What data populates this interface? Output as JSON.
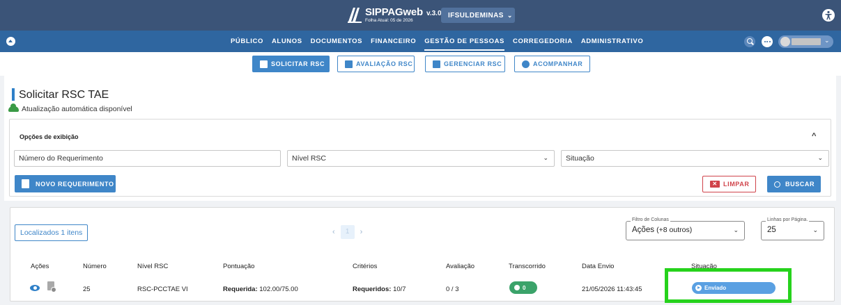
{
  "app": {
    "logo_name": "SIPPAG",
    "logo_name_suffix": "web",
    "version": "v.3.0",
    "payroll_label": "Folha Atual: 05 de 2026",
    "institution": "IFSULDEMINAS"
  },
  "nav": {
    "items": [
      "PÚBLICO",
      "ALUNOS",
      "DOCUMENTOS",
      "FINANCEIRO",
      "GESTÃO DE PESSOAS",
      "CORREGEDORIA",
      "ADMINISTRATIVO"
    ],
    "active": "GESTÃO DE PESSOAS"
  },
  "subnav": {
    "solicitar": "SOLICITAR RSC",
    "avaliacao": "AVALIAÇÃO RSC",
    "gerenciar": "GERENCIAR RSC",
    "acompanhar": "ACOMPANHAR"
  },
  "page": {
    "title": "Solicitar RSC TAE",
    "auto_update": "Atualização automática disponível"
  },
  "filters": {
    "title": "Opções de exibição",
    "numero_placeholder": "Número do Requerimento",
    "nivel_placeholder": "Nível RSC",
    "situacao_placeholder": "Situação",
    "novo_label": "NOVO REQUERIMENTO",
    "limpar_label": "LIMPAR",
    "buscar_label": "BUSCAR"
  },
  "results": {
    "found_label": "Localizados 1 itens",
    "current_page": "1",
    "prev": "‹",
    "next": "›",
    "column_filter": {
      "legend": "Filtro de Colunas",
      "value": "Ações",
      "extra": "(+8 outros)"
    },
    "rows_per_page": {
      "legend": "Linhas por Página.",
      "value": "25"
    },
    "columns": [
      "Ações",
      "Número",
      "Nível RSC",
      "Pontuação",
      "Critérios",
      "Avaliação",
      "Transcorrido",
      "Data Envio",
      "Situação"
    ],
    "rows": [
      {
        "numero": "25",
        "nivel": "RSC-PCCTAE VI",
        "pontuacao_label": "Requerida:",
        "pontuacao_value": "102.00/75.00",
        "criterios_label": "Requeridos:",
        "criterios_value": "10/7",
        "avaliacao": "0 / 3",
        "transcorrido": "0",
        "data_envio": "21/05/2026 11:43:45",
        "situacao": "Enviado"
      }
    ]
  },
  "colors": {
    "topbar": "#3b5478",
    "navbar": "#2f66a0",
    "primary": "#3f86c8",
    "danger": "#d0434a",
    "success": "#3ba36a",
    "status_sent": "#5aa0e2",
    "highlight": "#26d21c"
  },
  "icons": [
    "accessibility-icon",
    "menu-toggle-icon",
    "search-icon",
    "chat-icon",
    "avatar",
    "cloud-icon",
    "eye-icon",
    "document-icon",
    "timer-icon",
    "play-icon",
    "chevron-down-icon"
  ]
}
